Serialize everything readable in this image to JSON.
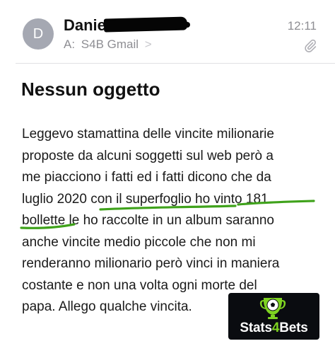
{
  "email": {
    "sender_initial": "D",
    "sender_name": "Daniel",
    "time": "12:11",
    "recipient_prefix": "A:",
    "recipient": "S4B Gmail",
    "recipient_chevron": ">",
    "attachment_icon": "paperclip-icon",
    "subject": "Nessun oggetto",
    "body_lines": [
      "Leggevo stamattina delle vincite milionarie",
      "proposte da alcuni soggetti sul web però a",
      "me piacciono i fatti ed i fatti dicono che da",
      "luglio 2020 con il superfoglio ho vinto 181",
      "bollette le ho raccolte in un album saranno",
      "anche vincite medio piccole che non mi",
      "renderanno milionario però vinci in maniera",
      "costante e non una volta ogni morte del",
      "papa. Allego qualche vincita."
    ]
  },
  "logo": {
    "text_part1": "Stats",
    "text_part2": "4",
    "text_part3": "Bets",
    "icon": "trophy-soccer-icon"
  },
  "colors": {
    "highlight_green": "#3fa21b",
    "brand_green": "#7ed321",
    "secondary_text": "#8e8e93",
    "avatar": "#a5a8b2"
  }
}
